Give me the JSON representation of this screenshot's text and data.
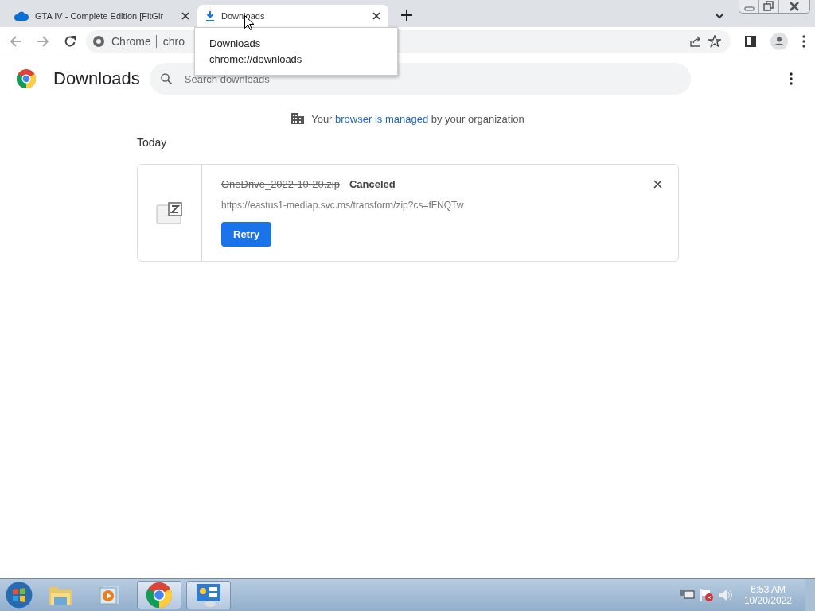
{
  "tabs": [
    {
      "title": "GTA IV - Complete Edition [FitGir",
      "kind": "cloud",
      "selected": false
    },
    {
      "title": "Downloads",
      "kind": "download",
      "selected": true
    }
  ],
  "tooltip": {
    "title": "Downloads",
    "url": "chrome://downloads"
  },
  "address_bar": {
    "site": "Chrome",
    "url": "chro"
  },
  "page": {
    "title": "Downloads",
    "search": {
      "placeholder": "Search downloads"
    },
    "managed_notice": {
      "before": "Your",
      "link": "browser is managed",
      "after": "by your organization"
    },
    "groups": [
      {
        "heading": "Today",
        "items": [
          {
            "file_name": "OneDrive_2022-10-20.zip",
            "canceled": true,
            "status": "Canceled",
            "url": "https://eastus1-mediap.svc.ms/transform/zip?cs=fFNQTw",
            "action": "Retry"
          }
        ]
      }
    ]
  },
  "taskbar": {
    "items": [
      {
        "kind": "explorer",
        "running": false
      },
      {
        "kind": "media",
        "running": false
      },
      {
        "kind": "chrome",
        "running": true
      },
      {
        "kind": "control",
        "running": true
      }
    ],
    "clock": {
      "time": "6:53 AM",
      "date": "10/20/2022"
    }
  }
}
